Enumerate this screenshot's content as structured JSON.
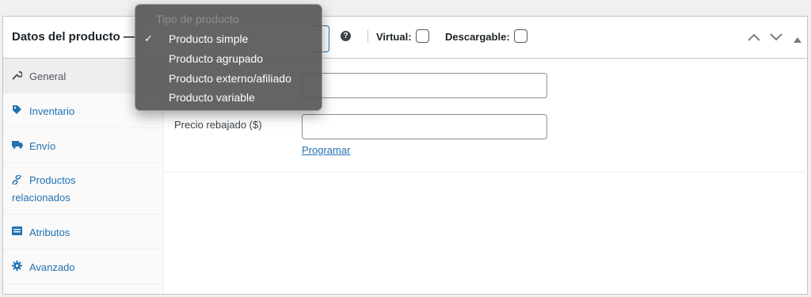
{
  "panel": {
    "title": "Datos del producto —",
    "help_icon": "question-icon",
    "virtual_label": "Virtual:",
    "downloadable_label": "Descargable:",
    "virtual_checked": false,
    "downloadable_checked": false,
    "header_buttons": [
      "chevron-up-icon",
      "chevron-down-icon",
      "triangle-up-icon"
    ]
  },
  "tabs": [
    {
      "label": "General",
      "icon": "wrench-icon",
      "active": true
    },
    {
      "label": "Inventario",
      "icon": "tag-icon",
      "active": false
    },
    {
      "label": "Envío",
      "icon": "truck-icon",
      "active": false
    },
    {
      "label": "Productos relacionados",
      "icon": "link-icon",
      "active": false
    },
    {
      "label": "Atributos",
      "icon": "list-icon",
      "active": false
    },
    {
      "label": "Avanzado",
      "icon": "gear-icon",
      "active": false
    }
  ],
  "general": {
    "sale_price_label": "Precio rebajado ($)",
    "regular_price_value": "",
    "sale_price_value": "",
    "schedule_link": "Programar"
  },
  "dropdown": {
    "header": "Tipo de producto",
    "selected": "Producto simple",
    "options": [
      "Producto simple",
      "Producto agrupado",
      "Producto externo/afiliado",
      "Producto variable"
    ]
  },
  "colors": {
    "link": "#2271b1",
    "border": "#c3c4c7",
    "dropdown_bg": "#585858"
  }
}
